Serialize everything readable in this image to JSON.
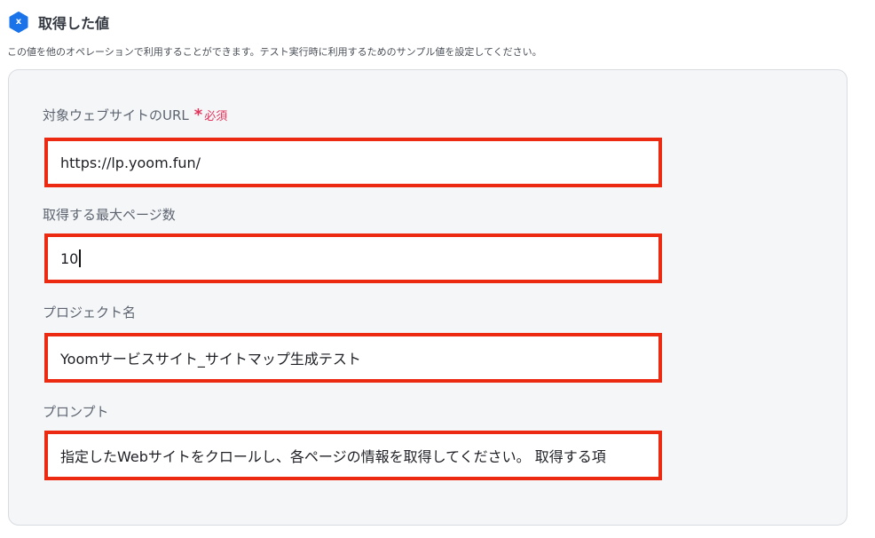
{
  "section": {
    "badge_letter": "x",
    "title": "取得した値",
    "description": "この値を他のオペレーションで利用することができます。テスト実行時に利用するためのサンプル値を設定してください。"
  },
  "fields": {
    "url": {
      "label": "対象ウェブサイトのURL",
      "required_mark": "*",
      "required_text": "必須",
      "value": "https://lp.yoom.fun/"
    },
    "max_pages": {
      "label": "取得する最大ページ数",
      "value": "10"
    },
    "project_name": {
      "label": "プロジェクト名",
      "value": "Yoomサービスサイト_サイトマップ生成テスト"
    },
    "prompt": {
      "label": "プロンプト",
      "value": "指定したWebサイトをクロールし、各ページの情報を取得してください。 取得する項"
    }
  },
  "colors": {
    "badge": "#1a73e8",
    "highlight_border": "#ec2a12",
    "required": "#e2335b",
    "panel_bg": "#f5f6f8"
  }
}
